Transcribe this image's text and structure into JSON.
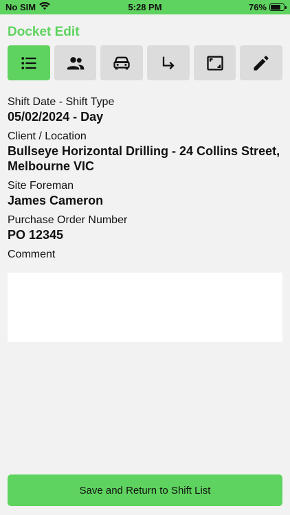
{
  "status_bar": {
    "carrier": "No SIM",
    "time": "5:28 PM",
    "battery_percent": "76%",
    "battery_level": 0.76
  },
  "header": {
    "title": "Docket Edit"
  },
  "tabs": [
    {
      "icon": "list-icon",
      "active": true
    },
    {
      "icon": "people-icon",
      "active": false
    },
    {
      "icon": "car-icon",
      "active": false
    },
    {
      "icon": "turn-right-arrow-icon",
      "active": false
    },
    {
      "icon": "crop-frame-icon",
      "active": false
    },
    {
      "icon": "pencil-icon",
      "active": false
    }
  ],
  "fields": {
    "shift": {
      "label": "Shift Date - Shift Type",
      "value": "05/02/2024 - Day"
    },
    "client": {
      "label": "Client / Location",
      "value": "Bullseye Horizontal Drilling - 24 Collins Street, Melbourne VIC"
    },
    "foreman": {
      "label": "Site Foreman",
      "value": "James Cameron"
    },
    "po": {
      "label": "Purchase Order Number",
      "value": "PO 12345"
    },
    "comment": {
      "label": "Comment",
      "value": ""
    }
  },
  "actions": {
    "save_label": "Save and Return to Shift List"
  },
  "colors": {
    "accent": "#5fd35f",
    "tab_inactive": "#dcdcdc",
    "background": "#f2f2f2"
  }
}
